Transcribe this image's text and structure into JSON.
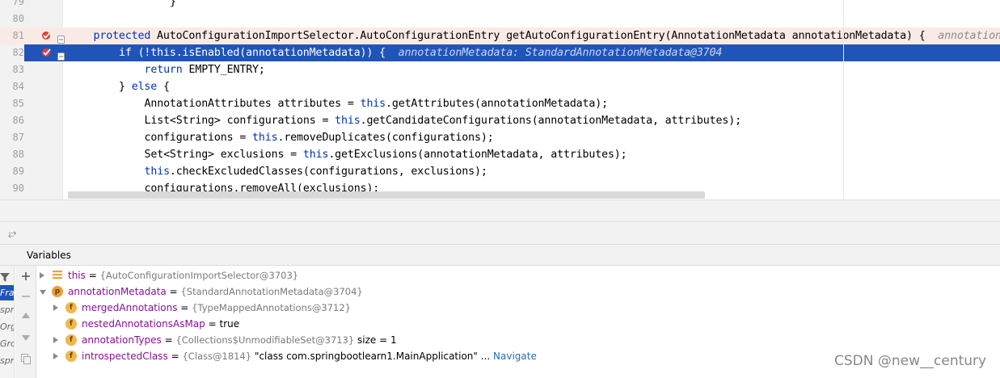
{
  "editor": {
    "lines": [
      {
        "num": "79",
        "indent": 4,
        "tokens": [
          {
            "t": "}"
          }
        ]
      },
      {
        "num": "80",
        "indent": 0,
        "tokens": []
      },
      {
        "num": "81",
        "indent": 1,
        "breakpoint": true,
        "bp_line": true,
        "tokens": [
          {
            "t": "protected",
            "c": "kw"
          },
          {
            "t": " AutoConfigurationImportSelector.AutoConfigurationEntry getAutoConfigurationEntry(AnnotationMetadata annotationMetadata) {  "
          },
          {
            "t": "annotationMeta",
            "c": "hint"
          }
        ]
      },
      {
        "num": "82",
        "indent": 2,
        "breakpoint": true,
        "current": true,
        "tokens": [
          {
            "t": "if (!"
          },
          {
            "t": "this",
            "c": "kw"
          },
          {
            "t": ".isEnabled(annotationMetadata)) {  "
          },
          {
            "t": "annotationMetadata: StandardAnnotationMetadata@3704",
            "c": "hint"
          }
        ]
      },
      {
        "num": "83",
        "indent": 3,
        "tokens": [
          {
            "t": "return",
            "c": "kw"
          },
          {
            "t": " EMPTY_ENTRY;"
          }
        ]
      },
      {
        "num": "84",
        "indent": 2,
        "tokens": [
          {
            "t": "} "
          },
          {
            "t": "else",
            "c": "kw"
          },
          {
            "t": " {"
          }
        ]
      },
      {
        "num": "85",
        "indent": 3,
        "tokens": [
          {
            "t": "AnnotationAttributes attributes = "
          },
          {
            "t": "this",
            "c": "kw"
          },
          {
            "t": ".getAttributes(annotationMetadata);"
          }
        ]
      },
      {
        "num": "86",
        "indent": 3,
        "tokens": [
          {
            "t": "List<String> configurations = "
          },
          {
            "t": "this",
            "c": "kw"
          },
          {
            "t": ".getCandidateConfigurations(annotationMetadata, attributes);"
          }
        ]
      },
      {
        "num": "87",
        "indent": 3,
        "tokens": [
          {
            "t": "configurations = "
          },
          {
            "t": "this",
            "c": "kw"
          },
          {
            "t": ".removeDuplicates(configurations);"
          }
        ]
      },
      {
        "num": "88",
        "indent": 3,
        "tokens": [
          {
            "t": "Set<String> exclusions = "
          },
          {
            "t": "this",
            "c": "kw"
          },
          {
            "t": ".getExclusions(annotationMetadata, attributes);"
          }
        ]
      },
      {
        "num": "89",
        "indent": 3,
        "tokens": [
          {
            "t": "this",
            "c": "kw"
          },
          {
            "t": ".checkExcludedClasses(configurations, exclusions);"
          }
        ]
      },
      {
        "num": "90",
        "indent": 3,
        "tokens": [
          {
            "t": "configurations.removeAll(exclusions);"
          }
        ]
      }
    ]
  },
  "panel": {
    "title": "Variables",
    "frames": [
      "",
      "Fran",
      "spr",
      "Org",
      "Gro",
      "spri"
    ]
  },
  "variables": [
    {
      "level": 0,
      "expand": "right",
      "icon": "this",
      "name": "this",
      "type": "{AutoConfigurationImportSelector@3703}",
      "value": "",
      "extra": "",
      "nav": ""
    },
    {
      "level": 0,
      "expand": "down",
      "icon": "p",
      "name": "annotationMetadata",
      "type": "{StandardAnnotationMetadata@3704}",
      "value": "",
      "extra": "",
      "nav": ""
    },
    {
      "level": 1,
      "expand": "right",
      "icon": "f",
      "name": "mergedAnnotations",
      "type": "{TypeMappedAnnotations@3712}",
      "value": "",
      "extra": "",
      "nav": ""
    },
    {
      "level": 1,
      "expand": "none",
      "icon": "f",
      "name": "nestedAnnotationsAsMap",
      "type": "",
      "value": "true",
      "extra": "",
      "nav": ""
    },
    {
      "level": 1,
      "expand": "right",
      "icon": "f",
      "name": "annotationTypes",
      "type": "{Collections$UnmodifiableSet@3713}",
      "value": "",
      "extra": " size = 1",
      "nav": ""
    },
    {
      "level": 1,
      "expand": "right",
      "icon": "f",
      "name": "introspectedClass",
      "type": "{Class@1814}",
      "value": "\"class com.springbootlearn1.MainApplication\"",
      "extra": " ...",
      "nav": "Navigate"
    }
  ],
  "watermark": "CSDN @new__century",
  "colors": {
    "current_line": "#2154b8",
    "breakpoint_line": "#faeae6",
    "keyword": "#0033b3",
    "var_name": "#871094"
  }
}
